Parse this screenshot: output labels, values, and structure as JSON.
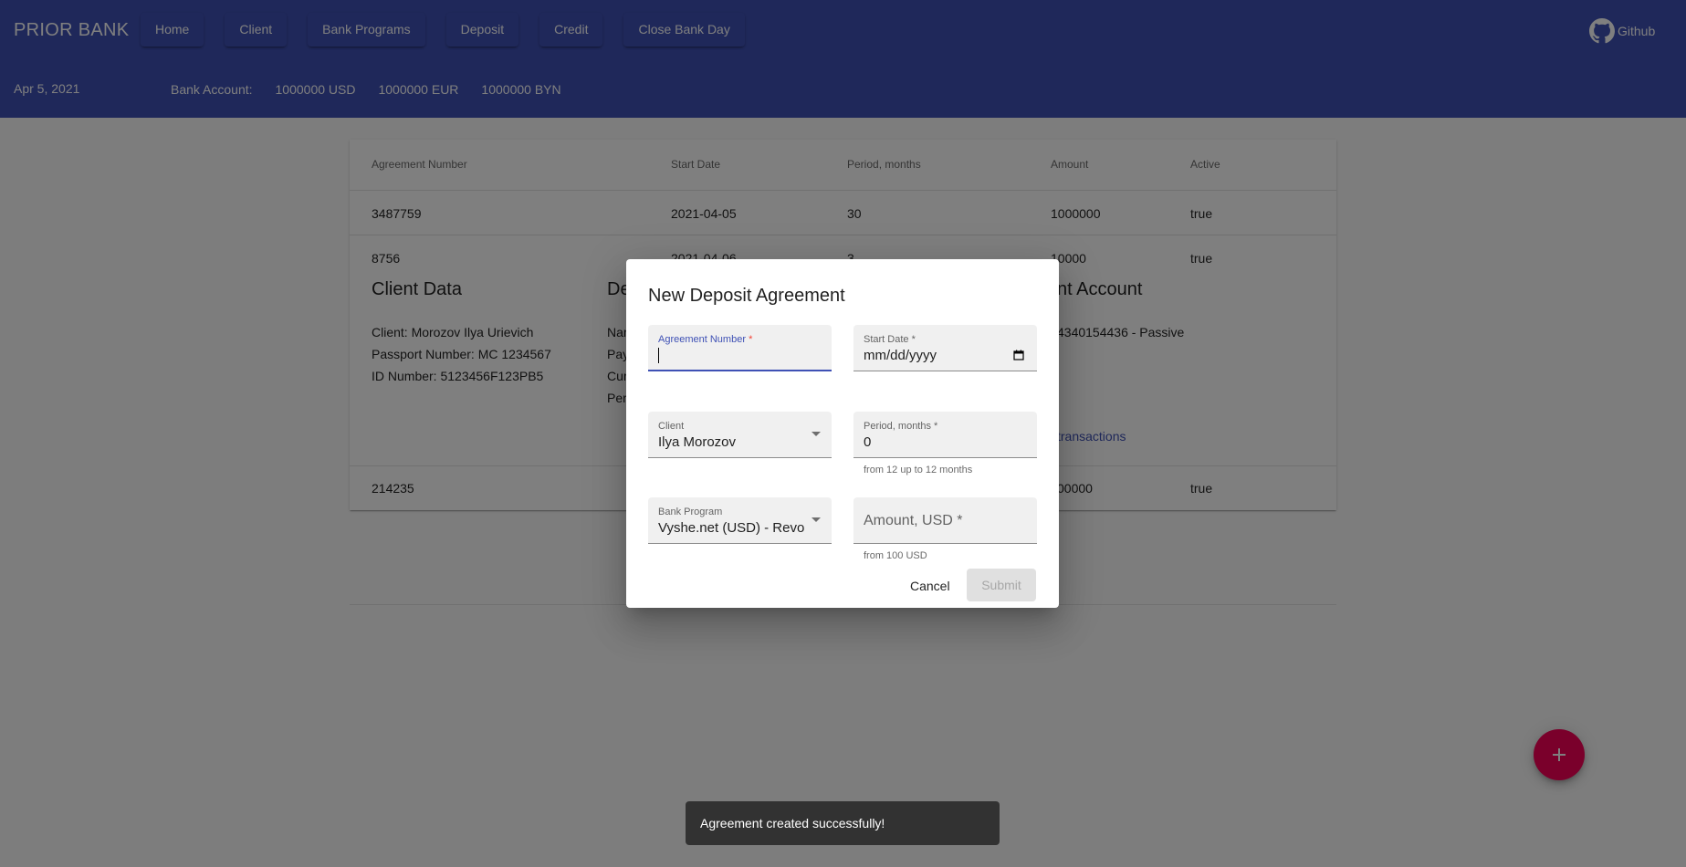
{
  "header": {
    "brand": "PRIOR BANK",
    "nav": [
      "Home",
      "Client",
      "Bank Programs",
      "Deposit",
      "Credit",
      "Close Bank Day"
    ],
    "github_label": "Github",
    "date": "Apr 5, 2021",
    "bank_account_label": "Bank Account:",
    "balances": [
      "1000000 USD",
      "1000000 EUR",
      "1000000 BYN"
    ]
  },
  "table": {
    "columns": [
      "Agreement Number",
      "Start Date",
      "Period, months",
      "Amount",
      "Active"
    ],
    "rows": [
      {
        "number": "3487759",
        "start": "2021-04-05",
        "period": "30",
        "amount": "1000000",
        "active": "true"
      },
      {
        "number": "8756",
        "start": "2021-04-06",
        "period": "3",
        "amount": "10000",
        "active": "true"
      },
      {
        "number": "214235",
        "amount": "00000",
        "active": "true"
      }
    ],
    "detail": {
      "client_title": "Client Data",
      "client_lines": [
        "Client: Morozov Ilya Urievich",
        "Passport Number: MC 1234567",
        "ID Number: 5123456F123PB5"
      ],
      "deposit_title_partial": "De",
      "deposit_lines_partial": [
        "Nar",
        "Pay",
        "Cur",
        "Per"
      ],
      "account_title_partial": "nt Account",
      "account_line_partial": "4340154436 - Passive",
      "transactions_link_partial": "transactions"
    }
  },
  "dialog": {
    "title": "New Deposit Agreement",
    "agreement_number": {
      "label": "Agreement Number",
      "required": "*",
      "value": ""
    },
    "start_date": {
      "label": "Start Date *",
      "value": "mm/dd/yyyy"
    },
    "client": {
      "label": "Client",
      "value": "Ilya Morozov"
    },
    "period": {
      "label": "Period, months *",
      "value": "0",
      "helper": "from 12 up to 12 months"
    },
    "bank_program": {
      "label": "Bank Program",
      "value": "Vyshe.net (USD) - Revoc..."
    },
    "amount": {
      "placeholder": "Amount, USD *",
      "helper": "from 100 USD"
    },
    "cancel": "Cancel",
    "submit": "Submit"
  },
  "snackbar": {
    "message": "Agreement created successfully!"
  },
  "colors": {
    "primary": "#3f51b5",
    "secondary": "#f50057"
  },
  "icons": {
    "github": "github-icon",
    "fab": "add-icon",
    "calendar": "calendar-icon"
  }
}
